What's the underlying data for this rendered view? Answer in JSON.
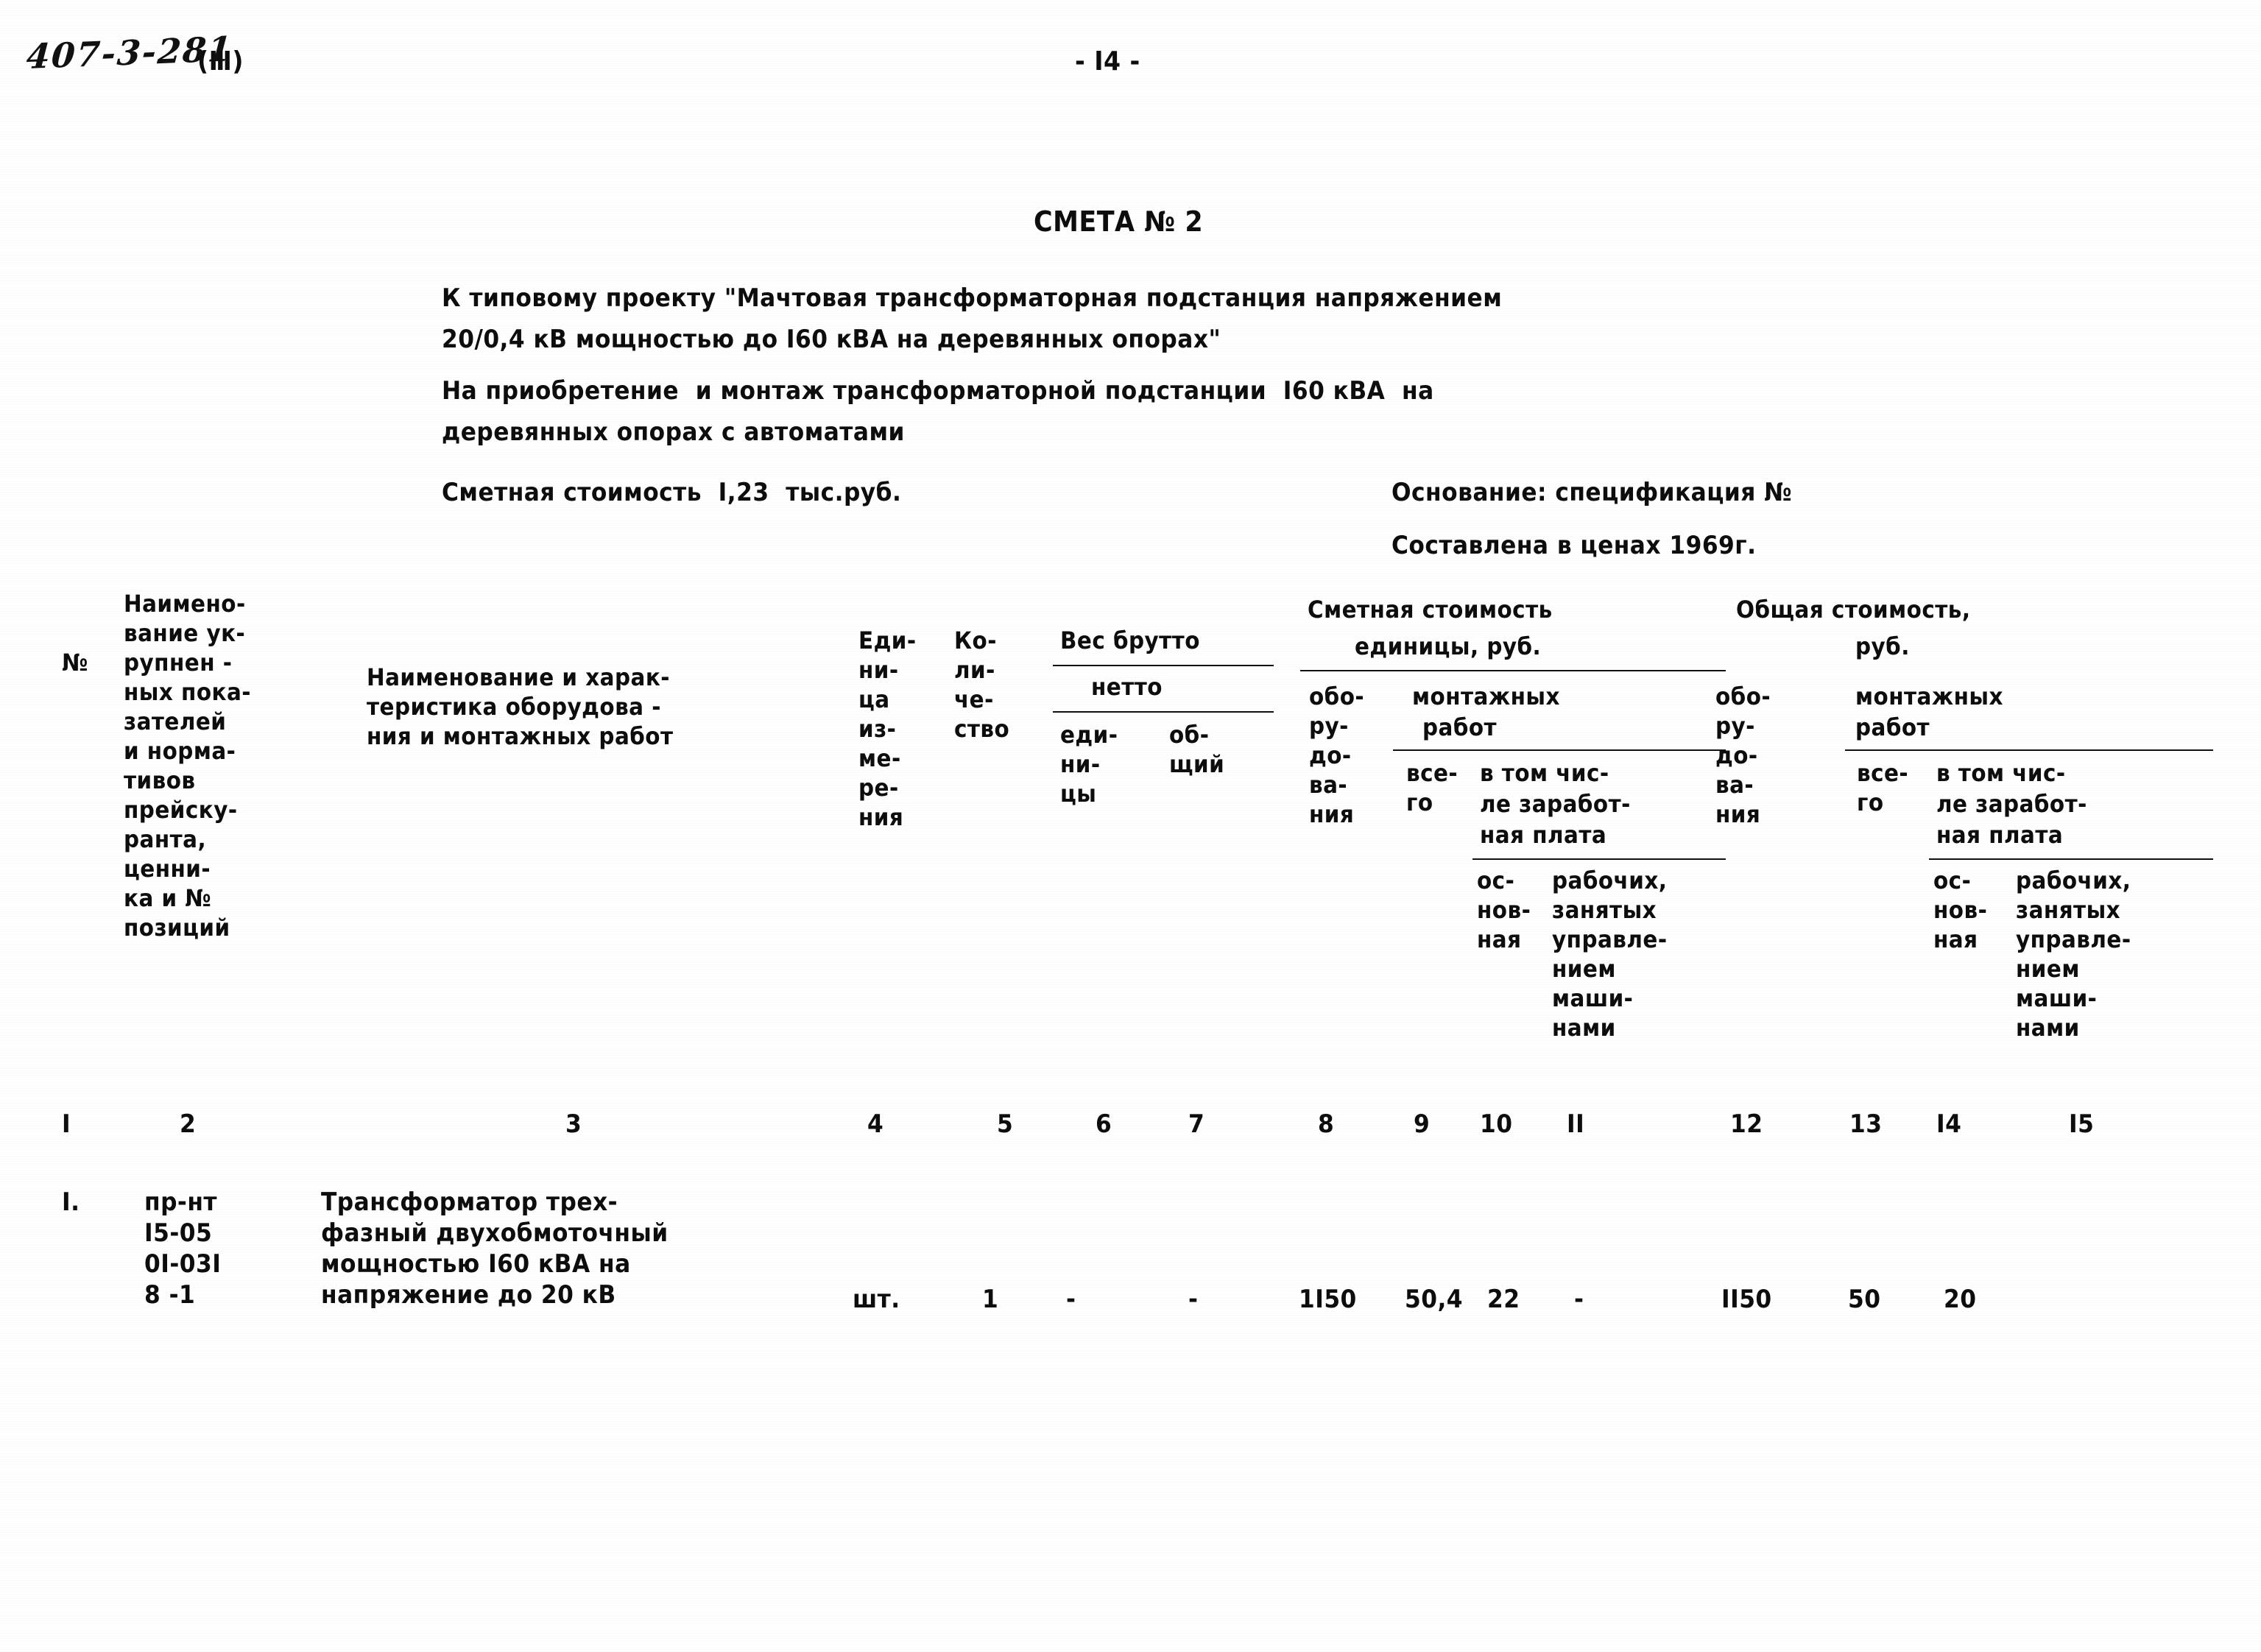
{
  "page": {
    "project_code": "407-3-281",
    "volume_marker": "(Ⅲ)",
    "page_number": "- I4 -"
  },
  "heading": {
    "title": "СМЕТА № 2",
    "subtitle_line1": "К типовому проекту \"Мачтовая трансформаторная подстанция напряжением",
    "subtitle_line2": "20/0,4 кВ мощностью до I60 кВА на деревянных опорах\"",
    "purpose_line1": "На приобретение  и монтаж трансформаторной подстанции  I60 кВА  на",
    "purpose_line2": "деревянных опорах с автоматами",
    "cost_label": "Сметная стоимость  I,23  тыс.руб.",
    "basis_line1": "Основание: спецификация №",
    "basis_line2": "Составлена в ценах 1969г."
  },
  "table": {
    "headers": {
      "col1": "№",
      "col2": "Наимено-\nвание ук-\nрупнен -\nных пока-\nзателей\nи норма-\nтивов\nпрейску-\nранта,\nценни-\nка и №\nпозиций",
      "col3": "Наименование и харак-\nтеристика оборудова -\nния и монтажных работ",
      "col4": "Еди-\nни-\nца\nиз-\nме-\nре-\nния",
      "col5": "Ко-\nли-\nче-\nство",
      "weight_group": "Вес брутто",
      "weight_net": "нетто",
      "col6": "еди-\nни-\nцы",
      "col7": "об-\nщий",
      "unit_cost_group_l1": "Сметная стоимость",
      "unit_cost_group_l2": "единицы, руб.",
      "col8": "обо-\nру-\nдо-\nва-\nния",
      "mount_works_l1": "монтажных",
      "mount_works_l2": "работ",
      "col9": "все-\nго",
      "col10_11_group_l1": "в том чис-",
      "col10_11_group_l2": "ле заработ-",
      "col10_11_group_l3": "ная плата",
      "col10": "ос-\nнов-\nная",
      "col11": "рабочих,\nзанятых\nуправле-\nнием\nмаши-\nнами",
      "total_cost_group_l1": "Общая стоимость,",
      "total_cost_group_l2": "руб.",
      "col12": "обо-\nру-\nдо-\nва-\nния",
      "mount_works2_l1": "монтажных",
      "mount_works2_l2": "работ",
      "col13": "все-\nго",
      "col14_15_group_l1": "в том чис-",
      "col14_15_group_l2": "ле заработ-",
      "col14_15_group_l3": "ная плата",
      "col14": "ос-\nнов-\nная",
      "col15": "рабочих,\nзанятых\nуправле-\nнием\nмаши-\nнами"
    },
    "column_numbers": [
      "I",
      "2",
      "3",
      "4",
      "5",
      "6",
      "7",
      "8",
      "9",
      "10",
      "II",
      "12",
      "13",
      "I4",
      "I5"
    ],
    "rows": [
      {
        "num": "I.",
        "code": "пр-нт\nI5-05\n0I-03I\n8 -1",
        "description": "Трансформатор трех-\nфазный двухобмоточный\nмощностью I60 кВА на\nнапряжение до 20 кВ",
        "unit": "шт.",
        "qty": "1",
        "weight_unit": "-",
        "weight_total": "-",
        "unit_equip": "1I50",
        "unit_mount_all": "50,4",
        "unit_wage_main": "22",
        "unit_wage_machine": "-",
        "total_equip": "II50",
        "total_mount_all": "50",
        "total_wage_main": "20",
        "total_wage_machine": ""
      }
    ]
  }
}
